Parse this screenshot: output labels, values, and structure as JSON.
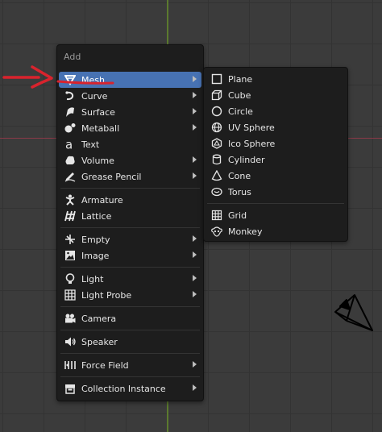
{
  "menu": {
    "title": "Add",
    "items": [
      {
        "label": "Mesh",
        "icon": "mesh-icon",
        "submenu": true,
        "active": true
      },
      {
        "label": "Curve",
        "icon": "curve-icon",
        "submenu": true
      },
      {
        "label": "Surface",
        "icon": "surface-icon",
        "submenu": true
      },
      {
        "label": "Metaball",
        "icon": "metaball-icon",
        "submenu": true
      },
      {
        "label": "Text",
        "icon": "text-icon",
        "submenu": false
      },
      {
        "label": "Volume",
        "icon": "volume-icon",
        "submenu": true
      },
      {
        "label": "Grease Pencil",
        "icon": "grease-pencil-icon",
        "submenu": true
      },
      {
        "label": "Armature",
        "icon": "armature-icon",
        "submenu": false
      },
      {
        "label": "Lattice",
        "icon": "lattice-icon",
        "submenu": false
      },
      {
        "label": "Empty",
        "icon": "empty-icon",
        "submenu": true
      },
      {
        "label": "Image",
        "icon": "image-icon",
        "submenu": true
      },
      {
        "label": "Light",
        "icon": "light-icon",
        "submenu": true
      },
      {
        "label": "Light Probe",
        "icon": "light-probe-icon",
        "submenu": true
      },
      {
        "label": "Camera",
        "icon": "camera-icon",
        "submenu": false
      },
      {
        "label": "Speaker",
        "icon": "speaker-icon",
        "submenu": false
      },
      {
        "label": "Force Field",
        "icon": "force-field-icon",
        "submenu": true
      },
      {
        "label": "Collection Instance",
        "icon": "collection-instance-icon",
        "submenu": true
      }
    ]
  },
  "mesh_submenu": {
    "items": [
      {
        "label": "Plane",
        "icon": "plane-icon"
      },
      {
        "label": "Cube",
        "icon": "cube-icon"
      },
      {
        "label": "Circle",
        "icon": "circle-icon"
      },
      {
        "label": "UV Sphere",
        "icon": "uv-sphere-icon"
      },
      {
        "label": "Ico Sphere",
        "icon": "ico-sphere-icon"
      },
      {
        "label": "Cylinder",
        "icon": "cylinder-icon"
      },
      {
        "label": "Cone",
        "icon": "cone-icon"
      },
      {
        "label": "Torus",
        "icon": "torus-icon"
      },
      {
        "label": "Grid",
        "icon": "grid-icon"
      },
      {
        "label": "Monkey",
        "icon": "monkey-icon"
      }
    ]
  },
  "colors": {
    "viewport_bg": "#3b3b3b",
    "menu_bg": "#1d1d1d",
    "highlight": "#4772b3",
    "annotation": "#d9232d",
    "y_axis": "#5b7a2e",
    "x_axis": "#8a3a48"
  }
}
